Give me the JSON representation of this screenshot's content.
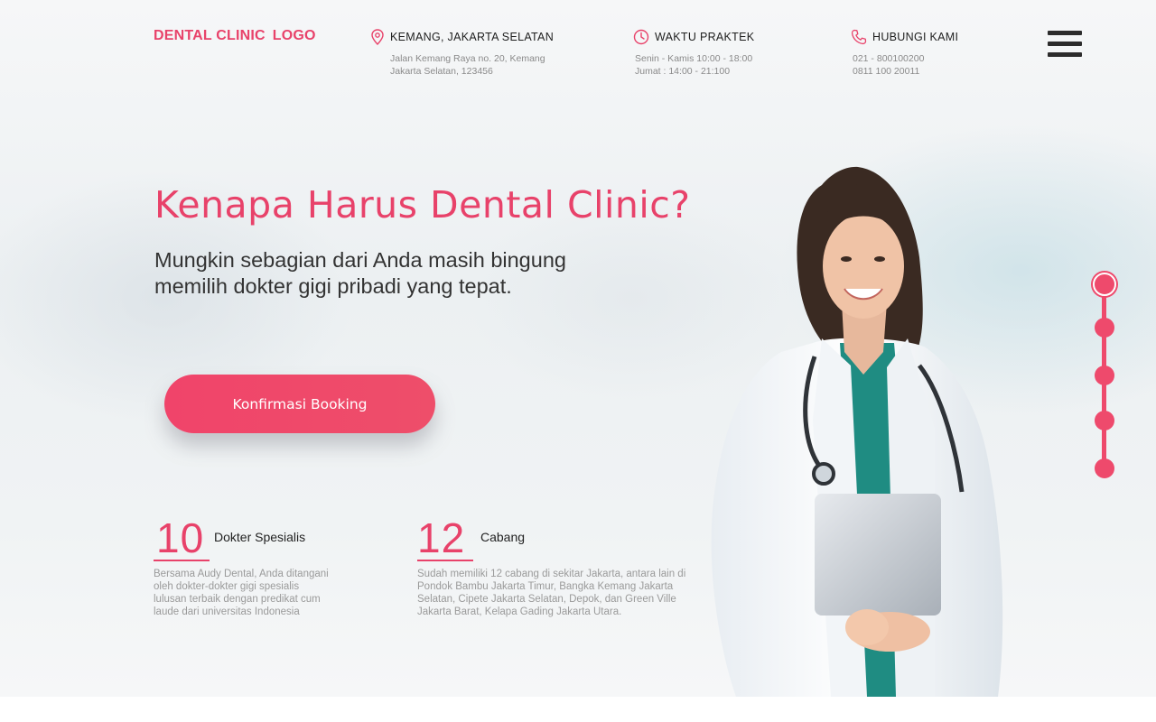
{
  "brand": {
    "logo_text": [
      "DENTAL CLINIC",
      "LOGO"
    ],
    "accent_color": "#e8426a"
  },
  "header": {
    "location": {
      "icon": "map-pin-icon",
      "title": "KEMANG, JAKARTA SELATAN",
      "lines": [
        "Jalan Kemang Raya no. 20, Kemang",
        "Jakarta Selatan, 123456"
      ]
    },
    "hours": {
      "icon": "clock-icon",
      "title": "WAKTU PRAKTEK",
      "lines": [
        "Senin - Kamis 10:00 - 18:00",
        "Jumat : 14:00 - 21:100"
      ]
    },
    "contact": {
      "icon": "phone-icon",
      "title": "HUBUNGI KAMI",
      "lines": [
        "021 - 800100200",
        "0811 100 20011"
      ]
    },
    "menu_icon": "hamburger-menu-icon"
  },
  "hero": {
    "headline": "Kenapa Harus Dental Clinic?",
    "subheadline_lines": [
      "Mungkin sebagian dari Anda masih bingung",
      "memilih dokter gigi pribadi yang tepat."
    ],
    "cta_label": "Konfirmasi Booking"
  },
  "stats": [
    {
      "number": "10",
      "label": "Dokter Spesialis",
      "description": "Bersama Audy Dental, Anda ditangani oleh dokter-dokter gigi spesialis lulusan terbaik dengan predikat cum laude dari universitas Indonesia"
    },
    {
      "number": "12",
      "label": "Cabang",
      "description": "Sudah memiliki 12 cabang di sekitar Jakarta, antara lain di Pondok Bambu Jakarta Timur, Bangka Kemang Jakarta Selatan, Cipete Jakarta Selatan, Depok, dan Green Ville Jakarta Barat, Kelapa Gading Jakarta Utara."
    }
  ],
  "slider": {
    "total_slides": 5,
    "active_index": 0
  }
}
